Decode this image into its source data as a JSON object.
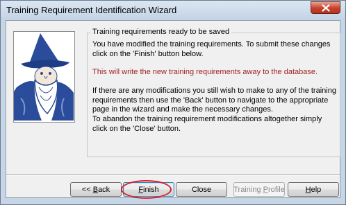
{
  "window": {
    "title": "Training Requirement Identification Wizard",
    "close_icon": "close-x-icon"
  },
  "wizard_image": {
    "icon": "wizard-icon"
  },
  "group": {
    "legend": "Training requirements ready to be saved",
    "paragraph1": "You have modified the training requirements.  To submit these changes click on the 'Finish' button below.",
    "paragraph2": "This will write the new training requirements away to the database.",
    "paragraph3": "If there are any modifications you still wish to make to any of the training requirements then use the 'Back' button to navigate to the appropriate page in the wizard and make the necessary changes.",
    "paragraph4": "To abandon the training requirement modifications altogether simply click on the 'Close' button."
  },
  "buttons": {
    "back": {
      "pre": "<< ",
      "mnemonic": "B",
      "post": "ack"
    },
    "finish": {
      "pre": "",
      "mnemonic": "F",
      "post": "inish"
    },
    "close": "Close",
    "training_profile": {
      "pre": "Training ",
      "mnemonic": "P",
      "post": "rofile"
    },
    "help": {
      "pre": "",
      "mnemonic": "H",
      "post": "elp"
    }
  },
  "colors": {
    "warning_text": "#a02020",
    "highlight_annotation": "#d8202a"
  }
}
